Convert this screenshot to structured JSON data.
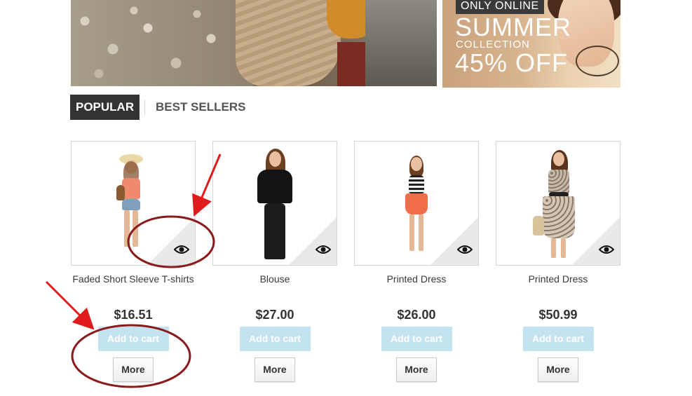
{
  "banner_side": {
    "tag": "ONLY ONLINE",
    "headline": "SUMMER",
    "subline": "COLLECTION",
    "discount": "45% OFF"
  },
  "slider": {
    "prev_icon": "chevron-left-icon",
    "next_icon": "chevron-right-icon"
  },
  "tabs": [
    {
      "label": "POPULAR",
      "active": true
    },
    {
      "label": "BEST SELLERS",
      "active": false
    }
  ],
  "products": [
    {
      "name": "Faded Short Sleeve T-shirts",
      "price": "$16.51",
      "add_label": "Add to cart",
      "more_label": "More",
      "icon": "eye-icon"
    },
    {
      "name": "Blouse",
      "price": "$27.00",
      "add_label": "Add to cart",
      "more_label": "More",
      "icon": "eye-icon"
    },
    {
      "name": "Printed Dress",
      "price": "$26.00",
      "add_label": "Add to cart",
      "more_label": "More",
      "icon": "eye-icon"
    },
    {
      "name": "Printed Dress",
      "price": "$50.99",
      "add_label": "Add to cart",
      "more_label": "More",
      "icon": "eye-icon"
    }
  ],
  "colors": {
    "annotation": "#e01b1b",
    "circle": "#8b1a1a",
    "add_to_cart_bg": "#c4e3f1",
    "tab_active_bg": "#333333"
  }
}
